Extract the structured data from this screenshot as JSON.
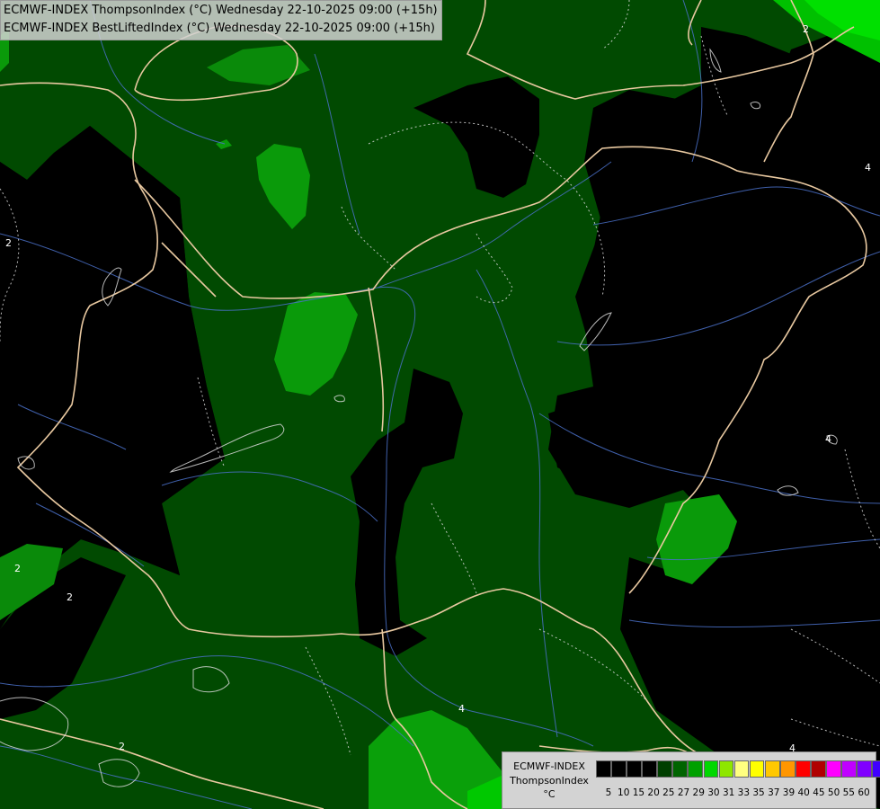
{
  "header": {
    "line1": "ECMWF-INDEX ThompsonIndex (°C) Wednesday 22-10-2025 09:00 (+15h)",
    "line2": "ECMWF-INDEX BestLiftedIndex (°C) Wednesday 22-10-2025 09:00 (+15h)"
  },
  "legend": {
    "line1": "ECMWF-INDEX",
    "line2": "ThompsonIndex",
    "line3": "°C",
    "swatch_colors": [
      "#000000",
      "#000000",
      "#000000",
      "#000000",
      "#003f00",
      "#006400",
      "#00a000",
      "#00d800",
      "#8ee600",
      "#ffff80",
      "#ffff00",
      "#ffc800",
      "#ff9600",
      "#ff0000",
      "#b00000",
      "#ff00ff",
      "#c000ff",
      "#8000ff",
      "#4000ff",
      "#0000ff"
    ],
    "ticks": [
      "5",
      "10",
      "15",
      "20",
      "25",
      "27",
      "29",
      "30",
      "31",
      "33",
      "35",
      "37",
      "39",
      "40",
      "45",
      "50",
      "55",
      "60"
    ]
  },
  "contour_labels": [
    "2",
    "2",
    "2",
    "2",
    "2",
    "4",
    "4",
    "4",
    "4"
  ],
  "colors": {
    "background": "#000000",
    "band_dark_green": "#014a01",
    "band_mid_green": "#006400",
    "band_light_green": "#0aa00a",
    "band_bright_green": "#00d400",
    "border": "#e8c8a0",
    "river": "#4a70c8",
    "isoline": "#d8d8d8"
  }
}
